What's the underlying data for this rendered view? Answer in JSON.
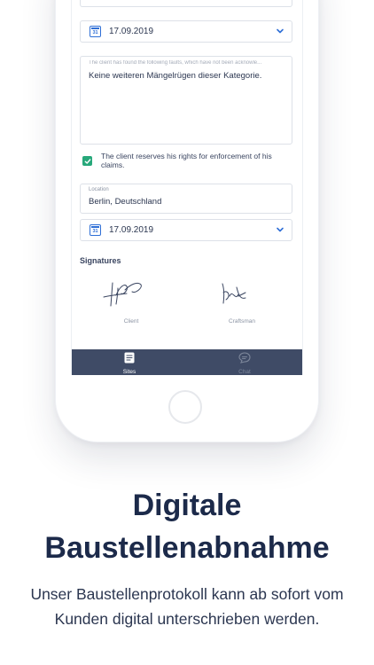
{
  "form": {
    "date_1": "17.09.2019",
    "faults_placeholder": "The client has found the following faults, which have not been acknowle...",
    "faults_value": "Keine weiteren Mängelrügen dieser Kategorie.",
    "rights_checkbox_label": "The client reserves his rights for enforcement of his claims.",
    "rights_checked": true,
    "location_label": "Location",
    "location_value": "Berlin, Deutschland",
    "date_2": "17.09.2019",
    "calendar_icon_text": "31"
  },
  "signatures": {
    "title": "Signatures",
    "client_label": "Client",
    "craftsman_label": "Craftsman"
  },
  "tabbar": {
    "tabs": [
      {
        "label": "Sites",
        "icon": "document-icon",
        "active": true
      },
      {
        "label": "Chat",
        "icon": "chat-icon",
        "active": false
      }
    ]
  },
  "marketing": {
    "headline_line1": "Digitale",
    "headline_line2": "Baustellenabnahme",
    "subtext_line1": "Unser Baustellenprotokoll kann ab sofort vom",
    "subtext_line2": "Kunden digital unterschrieben werden."
  },
  "colors": {
    "accent_blue": "#2f6fd6",
    "checkbox_green": "#27a87a",
    "tabbar_bg": "#3f4b66",
    "headline": "#1c2a4a"
  }
}
